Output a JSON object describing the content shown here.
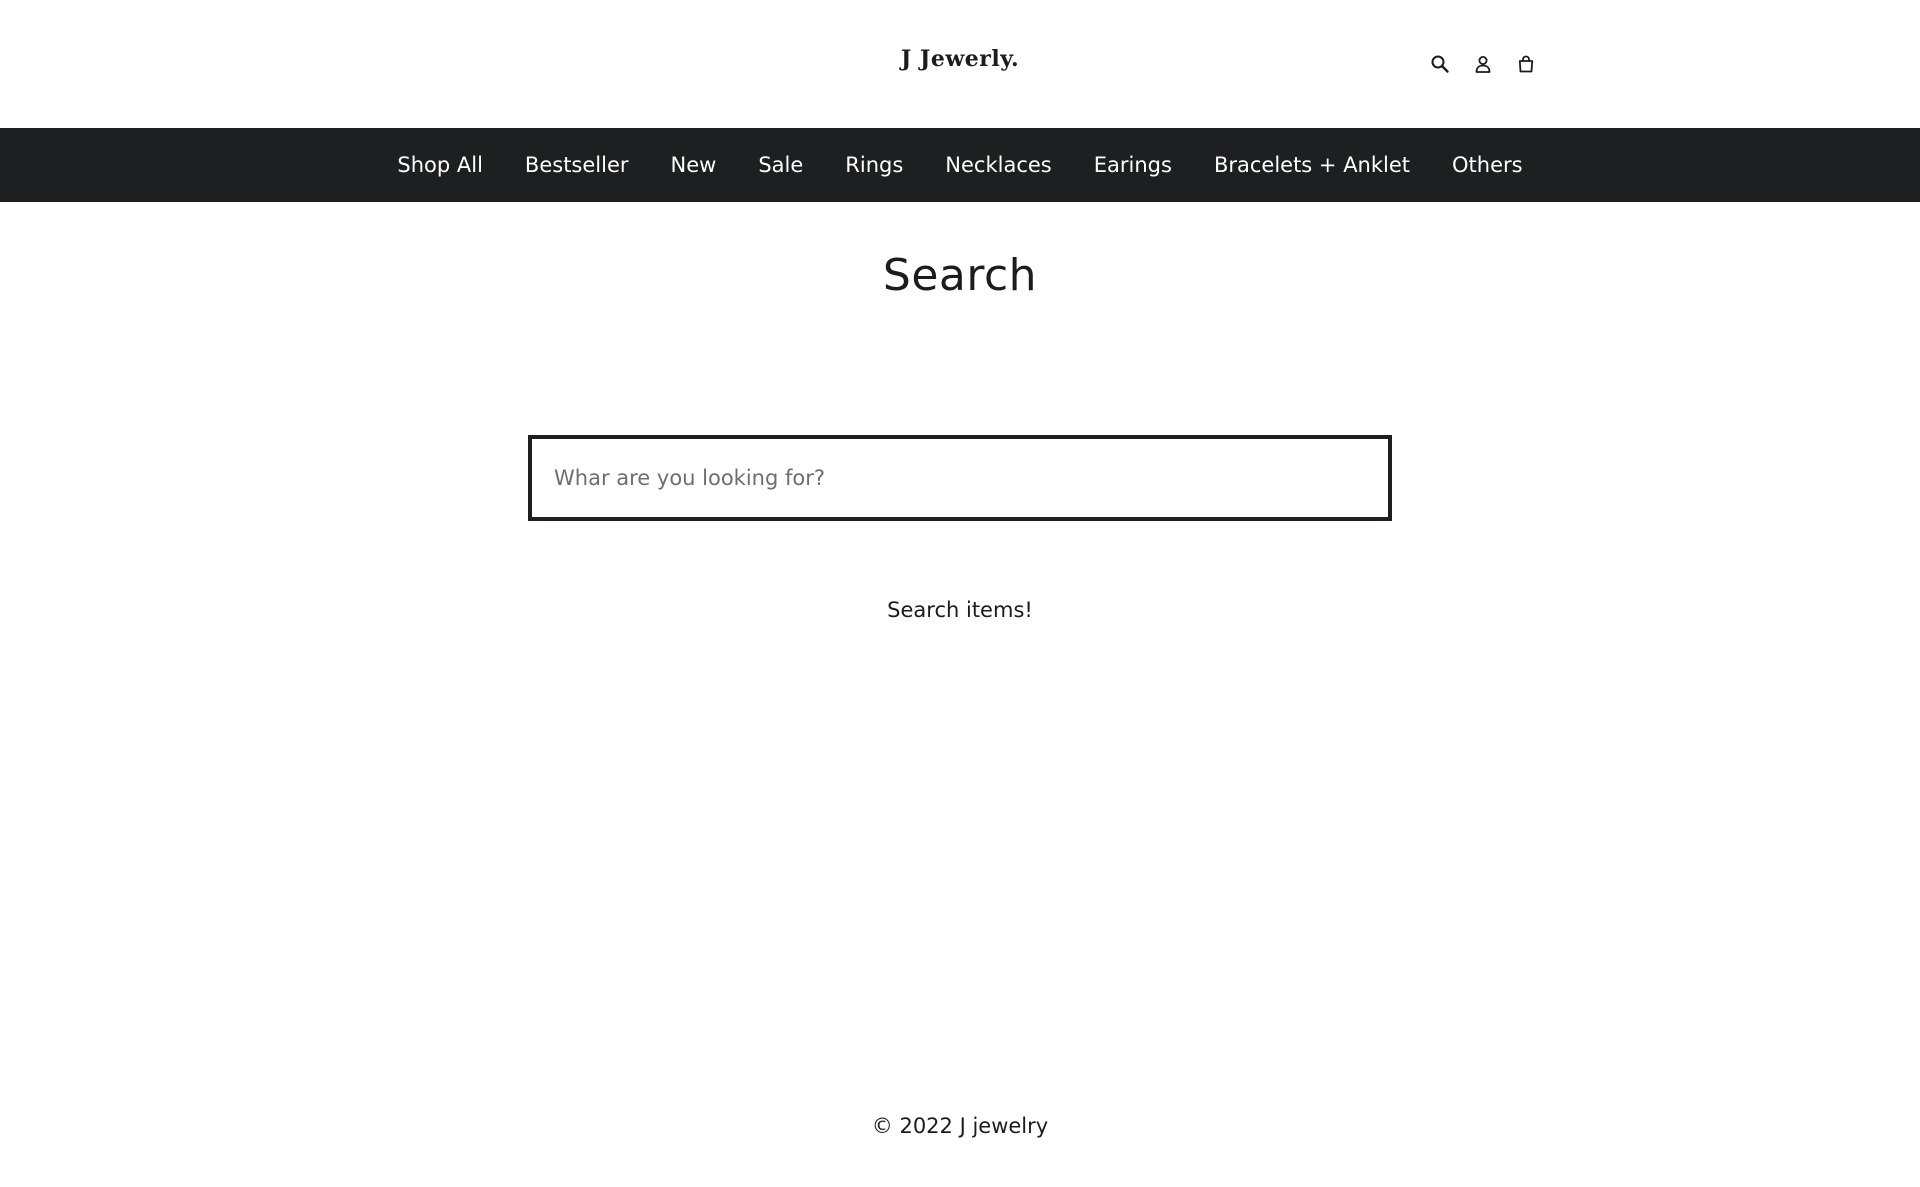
{
  "brand": {
    "logo_text": "J Jewerly."
  },
  "header": {
    "icons": [
      {
        "name": "search-icon",
        "label": "Search"
      },
      {
        "name": "account-icon",
        "label": "Log in"
      },
      {
        "name": "cart-icon",
        "label": "Cart"
      }
    ]
  },
  "nav": {
    "items": [
      {
        "label": "Shop All"
      },
      {
        "label": "Bestseller"
      },
      {
        "label": "New"
      },
      {
        "label": "Sale"
      },
      {
        "label": "Rings"
      },
      {
        "label": "Necklaces"
      },
      {
        "label": "Earings"
      },
      {
        "label": "Bracelets + Anklet"
      },
      {
        "label": "Others"
      }
    ]
  },
  "main": {
    "title": "Search",
    "search": {
      "value": "",
      "placeholder": "Whar are you looking for?"
    },
    "hint": "Search items!"
  },
  "footer": {
    "copyright": "© 2022 J jewelry"
  },
  "colors": {
    "nav_background": "#1e1f21",
    "text": "#1c1c1e",
    "background": "#ffffff"
  }
}
